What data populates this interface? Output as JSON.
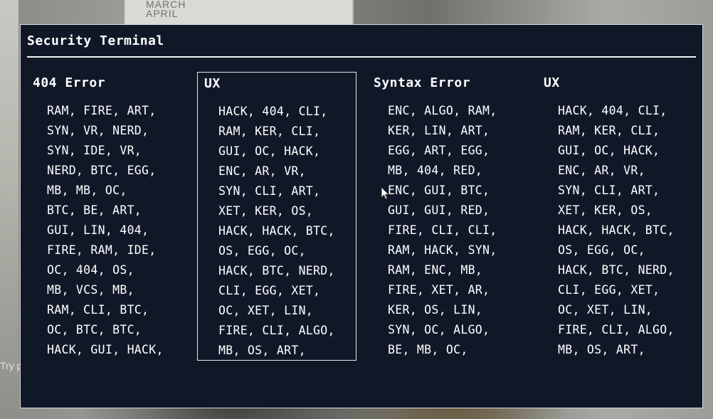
{
  "background": {
    "board_text": "MARCH\nAPRIL",
    "hint_text": "Try p"
  },
  "terminal": {
    "title": "Security Terminal",
    "columns": [
      {
        "title": "404 Error",
        "selected": false,
        "rows": [
          "RAM, FIRE, ART,",
          "SYN, VR, NERD,",
          "SYN, IDE, VR,",
          "NERD, BTC, EGG,",
          "MB, MB, OC,",
          "BTC, BE, ART,",
          "GUI, LIN, 404,",
          "FIRE, RAM, IDE,",
          "OC, 404, OS,",
          "MB, VCS, MB,",
          "RAM, CLI, BTC,",
          "OC, BTC, BTC,",
          "HACK, GUI, HACK,"
        ]
      },
      {
        "title": "UX",
        "selected": true,
        "rows": [
          "HACK, 404, CLI,",
          "RAM, KER, CLI,",
          "GUI, OC, HACK,",
          "ENC, AR, VR,",
          "SYN, CLI, ART,",
          "XET, KER, OS,",
          "HACK, HACK, BTC,",
          "OS, EGG, OC,",
          "HACK, BTC, NERD,",
          "CLI, EGG, XET,",
          "OC, XET, LIN,",
          "FIRE, CLI, ALGO,",
          "MB, OS, ART,"
        ]
      },
      {
        "title": "Syntax Error",
        "selected": false,
        "rows": [
          "ENC, ALGO, RAM,",
          "KER, LIN, ART,",
          "EGG, ART, EGG,",
          "MB, 404, RED,",
          "ENC, GUI, BTC,",
          "GUI, GUI, RED,",
          "FIRE, CLI, CLI,",
          "RAM, HACK, SYN,",
          "RAM, ENC, MB,",
          "FIRE, XET, AR,",
          "KER, OS, LIN,",
          "SYN, OC, ALGO,",
          "BE, MB, OC,"
        ]
      },
      {
        "title": "UX",
        "selected": false,
        "rows": [
          "HACK, 404, CLI,",
          "RAM, KER, CLI,",
          "GUI, OC, HACK,",
          "ENC, AR, VR,",
          "SYN, CLI, ART,",
          "XET, KER, OS,",
          "HACK, HACK, BTC,",
          "OS, EGG, OC,",
          "HACK, BTC, NERD,",
          "CLI, EGG, XET,",
          "OC, XET, LIN,",
          "FIRE, CLI, ALGO,",
          "MB, OS, ART,"
        ]
      }
    ]
  },
  "cursor": {
    "icon": "mouse-pointer-icon"
  }
}
